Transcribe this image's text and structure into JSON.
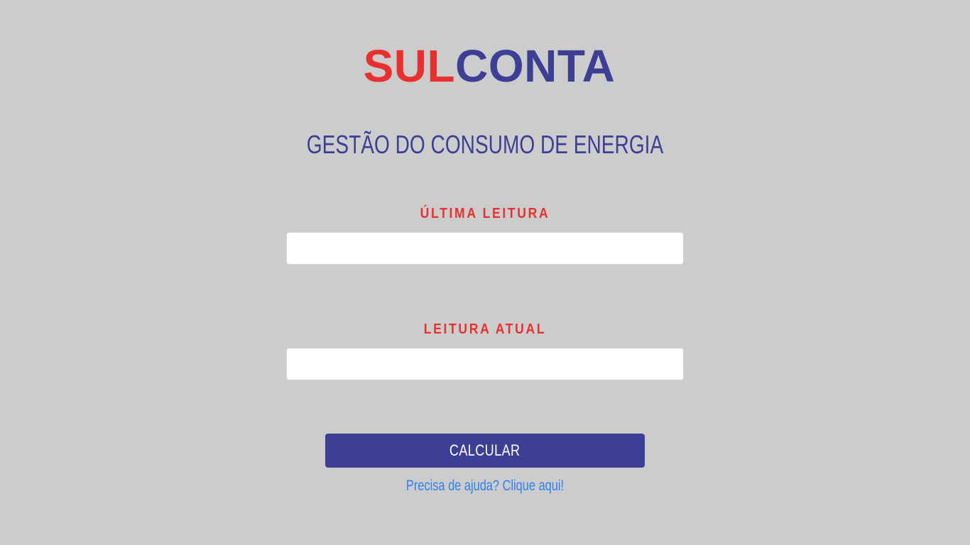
{
  "logo": {
    "part1": "SUL",
    "part2": "CONTA",
    "color_part1": "#e8302f",
    "color_part2": "#3d3f95"
  },
  "subtitle": "GESTÃO DO CONSUMO DE ENERGIA",
  "form": {
    "last_reading": {
      "label": "ÚLTIMA LEITURA",
      "value": "",
      "placeholder": ""
    },
    "current_reading": {
      "label": "LEITURA ATUAL",
      "value": "",
      "placeholder": ""
    },
    "submit_label": "CALCULAR"
  },
  "help_link": "Precisa de ajuda? Clique aqui!",
  "colors": {
    "background": "#cccccc",
    "accent_red": "#e8302f",
    "accent_blue": "#3d3f95",
    "link": "#2f80ed"
  }
}
